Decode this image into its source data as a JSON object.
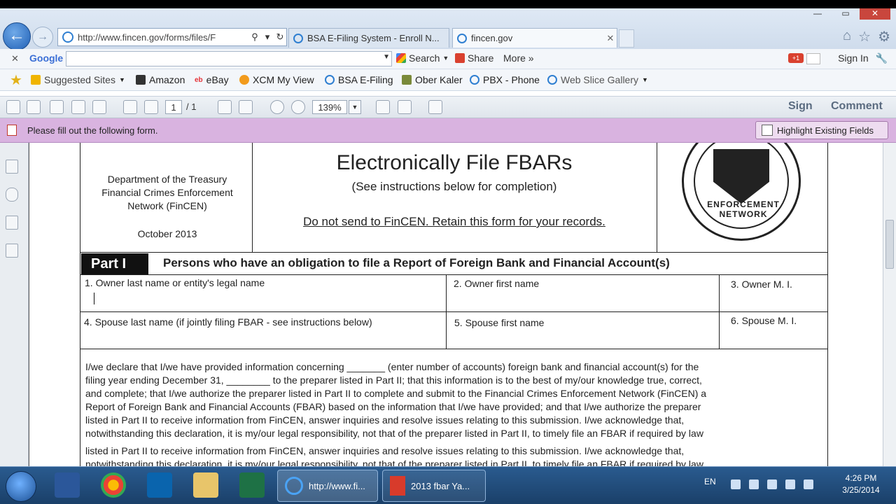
{
  "browser": {
    "url": "http://www.fincen.gov/forms/files/F",
    "tabs": [
      {
        "label": "BSA E-Filing System - Enroll N..."
      },
      {
        "label": "fincen.gov"
      }
    ]
  },
  "google_toolbar": {
    "logo": "Google",
    "search_label": "Search",
    "share_label": "Share",
    "more_label": "More »",
    "signin_label": "Sign In"
  },
  "favorites": [
    {
      "label": "Suggested Sites",
      "icon": "suggested-sites-icon",
      "color": "#f0b400"
    },
    {
      "label": "Amazon",
      "icon": "amazon-icon",
      "color": "#333333"
    },
    {
      "label": "eBay",
      "icon": "ebay-icon",
      "color": "#e53238"
    },
    {
      "label": "XCM My View",
      "icon": "xcm-icon",
      "color": "#f29b1d"
    },
    {
      "label": "BSA E-Filing",
      "icon": "ie-page-icon",
      "color": "#2f7fd1"
    },
    {
      "label": "Ober Kaler",
      "icon": "ober-kaler-icon",
      "color": "#7a8a3a"
    },
    {
      "label": "PBX - Phone",
      "icon": "ie-page-icon",
      "color": "#2f7fd1"
    },
    {
      "label": "Web Slice Gallery",
      "icon": "ie-page-icon",
      "color": "#2f7fd1"
    }
  ],
  "pdf_toolbar": {
    "page_current": "1",
    "page_total": "/ 1",
    "zoom": "139%",
    "sign_label": "Sign",
    "comment_label": "Comment"
  },
  "form_notice": {
    "text": "Please fill out the following form.",
    "highlight_label": "Highlight Existing Fields"
  },
  "document": {
    "header_left": [
      "Department of the Treasury",
      "Financial Crimes Enforcement",
      "Network (FinCEN)"
    ],
    "date": "October 2013",
    "title": "Electronically File FBARs",
    "subtitle": "(See instructions below for completion)",
    "notice": "Do not send to FinCEN. Retain this form for your records.",
    "part_label": "Part I",
    "part_title": "Persons who have an obligation to file a Report of Foreign Bank and Financial Account(s)",
    "fields": {
      "f1": "1. Owner last name or entity's legal name",
      "f2": "2.  Owner first name",
      "f3": "3. Owner M. I.",
      "f4": "4. Spouse last name (if jointly filing FBAR - see instructions below)",
      "f5": "5.  Spouse  first name",
      "f6": "6. Spouse M. I."
    },
    "declaration": [
      "I/we declare that I/we have provided information concerning _______ (enter number of accounts) foreign bank and financial account(s) for the",
      "filing year ending December 31, ________ to the preparer listed in Part II; that this information is to the best of my/our knowledge true, correct,",
      "and complete; that I/we authorize the preparer listed in Part II to complete and submit to the Financial Crimes Enforcement Network (FinCEN) a",
      "Report of Foreign Bank and Financial Accounts (FBAR) based on the information that I/we have provided; and that I/we authorize the preparer",
      "listed in Part II to receive information from FinCEN, answer inquiries and resolve issues relating to this submission.  I/we acknowledge that,",
      "notwithstanding this declaration, it is my/our legal responsibility, not that of the preparer listed in Part II, to timely file an FBAR if required by law",
      "listed in Part II to receive information from FinCEN, answer inquiries and resolve issues relating to this submission.  I/we acknowledge that,",
      "notwithstanding this declaration, it is my/our legal responsibility, not that of the preparer listed in Part II, to timely file an FBAR if required by law"
    ]
  },
  "taskbar": {
    "ie_window": "http://www.fi...",
    "pdf_window": "2013 fbar Ya...",
    "language": "EN",
    "time": "4:26 PM",
    "date": "3/25/2014"
  }
}
